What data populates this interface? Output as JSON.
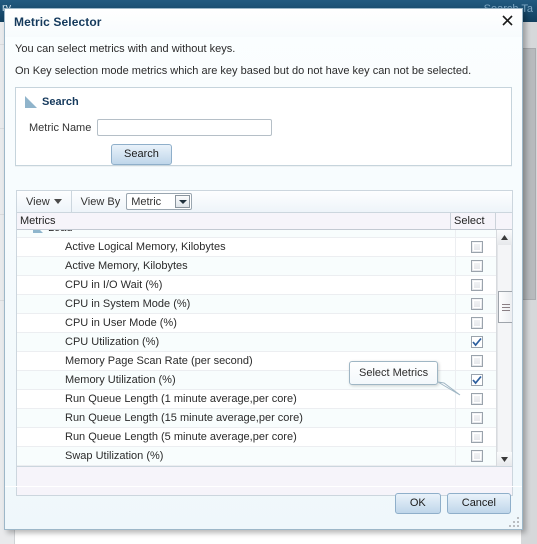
{
  "background": {
    "topbar_left": "ry",
    "topbar_right": "Search Ta"
  },
  "dialog": {
    "title": "Metric Selector",
    "close_icon": "close-icon",
    "intro_line1": "You can select metrics with and without keys.",
    "intro_line2": "On Key selection mode metrics which are key based but do not have key can not be selected.",
    "search": {
      "header": "Search",
      "metric_name_label": "Metric Name",
      "metric_name_value": "",
      "metric_name_placeholder": "",
      "search_button": "Search"
    },
    "toolbar": {
      "view_label": "View",
      "view_by_label": "View By",
      "view_by_value": "Metric",
      "view_by_options": [
        "Metric"
      ]
    },
    "table": {
      "columns": [
        "Metrics",
        "Select"
      ],
      "rows": [
        {
          "label": "Load",
          "type": "group",
          "checkbox": null
        },
        {
          "label": "Active Logical Memory, Kilobytes",
          "type": "child",
          "checkbox": false
        },
        {
          "label": "Active Memory, Kilobytes",
          "type": "child",
          "checkbox": false
        },
        {
          "label": "CPU in I/O Wait (%)",
          "type": "child",
          "checkbox": false
        },
        {
          "label": "CPU in System Mode (%)",
          "type": "child",
          "checkbox": false
        },
        {
          "label": "CPU in User Mode (%)",
          "type": "child",
          "checkbox": false
        },
        {
          "label": "CPU Utilization (%)",
          "type": "child",
          "checkbox": true
        },
        {
          "label": "Memory Page Scan Rate (per second)",
          "type": "child",
          "checkbox": false
        },
        {
          "label": "Memory Utilization (%)",
          "type": "child",
          "checkbox": true
        },
        {
          "label": "Run Queue Length (1 minute average,per core)",
          "type": "child",
          "checkbox": false
        },
        {
          "label": "Run Queue Length (15 minute average,per core)",
          "type": "child",
          "checkbox": false
        },
        {
          "label": "Run Queue Length (5 minute average,per core)",
          "type": "child",
          "checkbox": false
        },
        {
          "label": "Swap Utilization (%)",
          "type": "child",
          "checkbox": false
        }
      ]
    },
    "tooltip": {
      "text": "Select Metrics"
    },
    "footer": {
      "ok_label": "OK",
      "cancel_label": "Cancel"
    }
  },
  "colors": {
    "topbar": "#1b4f72",
    "dialog_border": "#9db7c8",
    "title_text": "#14395c",
    "button_face": "#bfd6ea",
    "checkbox_tick": "#2c5f9e",
    "row_alt": "#f8fdfd"
  }
}
